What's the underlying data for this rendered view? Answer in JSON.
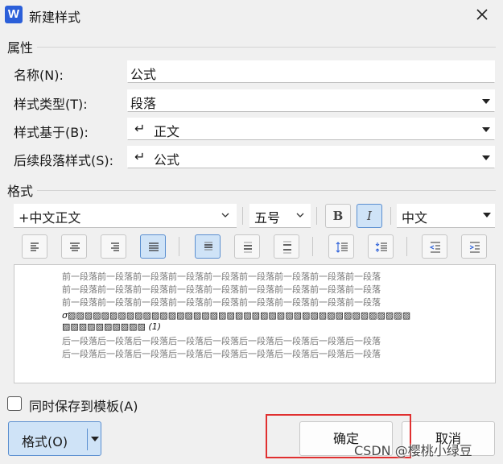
{
  "window": {
    "title": "新建样式",
    "app_icon": "W"
  },
  "properties": {
    "section_label": "属性",
    "name": {
      "label": "名称(N):",
      "value": "公式"
    },
    "style_type": {
      "label": "样式类型(T):",
      "value": "段落"
    },
    "based_on": {
      "label": "样式基于(B):",
      "value": "正文"
    },
    "following": {
      "label": "后续段落样式(S):",
      "value": "公式"
    }
  },
  "format": {
    "section_label": "格式",
    "font": "+中文正文",
    "size": "五号",
    "bold_label": "B",
    "italic_label": "I",
    "script": "中文"
  },
  "preview": {
    "lines": [
      "前一段落前一段落前一段落前一段落前一段落前一段落前一段落前一段落前一段落",
      "前一段落前一段落前一段落前一段落前一段落前一段落前一段落前一段落前一段落",
      "前一段落前一段落前一段落前一段落前一段落前一段落前一段落前一段落前一段落",
      "σ▨▨▨▨▨▨▨▨▨▨▨▨▨▨▨▨▨▨▨▨▨▨▨▨▨▨▨▨▨▨▨▨▨▨▨▨▨▨▨▨▨",
      "▨▨▨▨▨▨▨▨▨▨ (1)",
      "后一段落后一段落后一段落后一段落后一段落后一段落后一段落后一段落后一段落",
      "后一段落后一段落后一段落后一段落后一段落后一段落后一段落后一段落后一段落"
    ]
  },
  "save_to_template": {
    "label": "同时保存到模板(A)",
    "checked": false
  },
  "buttons": {
    "format": "格式(O)",
    "ok": "确定",
    "cancel": "取消"
  },
  "watermark": "CSDN @樱桃小绿豆",
  "colors": {
    "accent": "#cfe3f7",
    "accent_border": "#5b8fd0",
    "highlight": "#e03030",
    "app_icon": "#2b5fd9"
  }
}
